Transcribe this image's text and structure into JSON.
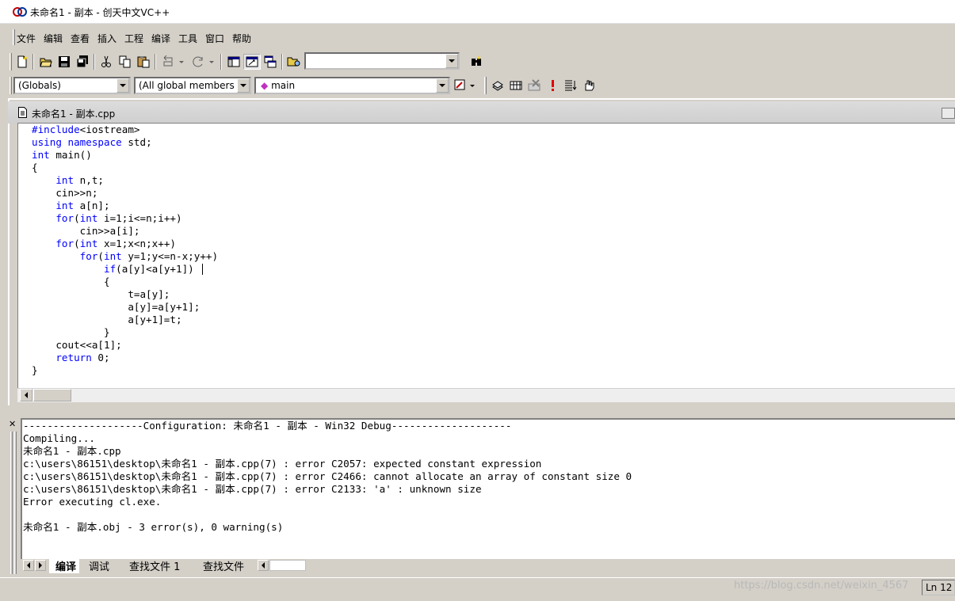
{
  "window": {
    "title": "未命名1 - 副本 - 创天中文VC++"
  },
  "menu": [
    "文件",
    "编辑",
    "查看",
    "插入",
    "工程",
    "编译",
    "工具",
    "窗口",
    "帮助"
  ],
  "toolbar": {
    "find_combo_value": "",
    "icons": [
      "new-file-icon",
      "open-folder-icon",
      "save-icon",
      "save-all-icon",
      "cut-icon",
      "copy-icon",
      "paste-icon",
      "undo-icon",
      "redo-icon",
      "workspace-icon",
      "output-icon",
      "window-list-icon",
      "find-in-files-icon",
      "find-icon"
    ]
  },
  "wizardbar": {
    "scope": "(Globals)",
    "members": "(All global members",
    "function": "main"
  },
  "editor": {
    "tab_title": "未命名1 - 副本.cpp",
    "code": [
      "#include<iostream>",
      "using namespace std;",
      "int main()",
      "{",
      "    int n,t;",
      "    cin>>n;",
      "    int a[n];",
      "    for(int i=1;i<=n;i++)",
      "        cin>>a[i];",
      "    for(int x=1;x<n;x++)",
      "        for(int y=1;y<=n-x;y++)",
      "            if(a[y]<a[y+1])",
      "            {",
      "                t=a[y];",
      "                a[y]=a[y+1];",
      "                a[y+1]=t;",
      "            }",
      "    cout<<a[1];",
      "    return 0;",
      "}"
    ],
    "keyword_color": "#0000ff"
  },
  "output": {
    "lines": [
      "--------------------Configuration: 未命名1 - 副本 - Win32 Debug--------------------",
      "Compiling...",
      "未命名1 - 副本.cpp",
      "c:\\users\\86151\\desktop\\未命名1 - 副本.cpp(7) : error C2057: expected constant expression",
      "c:\\users\\86151\\desktop\\未命名1 - 副本.cpp(7) : error C2466: cannot allocate an array of constant size 0",
      "c:\\users\\86151\\desktop\\未命名1 - 副本.cpp(7) : error C2133: 'a' : unknown size",
      "Error executing cl.exe.",
      "",
      "未命名1 - 副本.obj - 3 error(s), 0 warning(s)"
    ],
    "tabs": [
      "编译",
      "调试",
      "查找文件 1",
      "查找文件"
    ]
  },
  "status": {
    "line": "Ln 12",
    "watermark": "https://blog.csdn.net/weixin_4567"
  }
}
